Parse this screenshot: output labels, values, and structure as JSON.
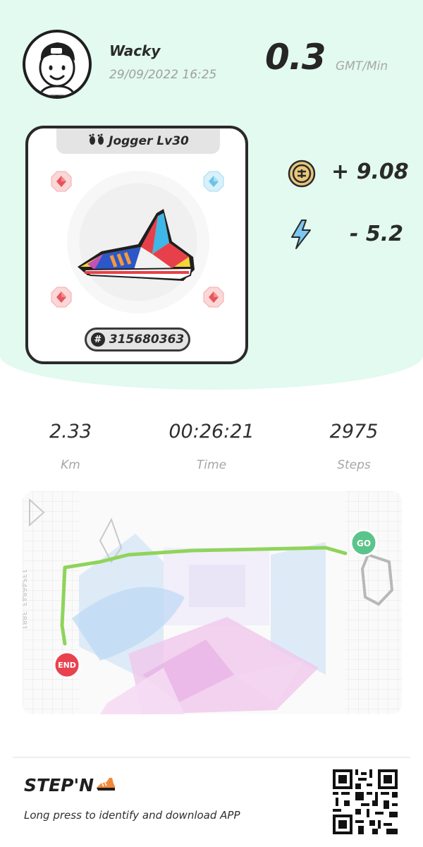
{
  "profile": {
    "username": "Wacky",
    "datetime": "29/09/2022 16:25",
    "avatar_icon": "cartoon-avatar-icon"
  },
  "earning_rate": {
    "value": "0.3",
    "unit": "GMT/Min"
  },
  "sneaker": {
    "level_label": "Jogger Lv30",
    "level_icon": "footprints-icon",
    "id_number": "315680363",
    "id_icon": "hash-icon",
    "socket_colors": {
      "red": "#f07a7a",
      "blue": "#8fd4ee"
    }
  },
  "rewards": [
    {
      "icon": "gst-coin-icon",
      "value": "+ 9.08",
      "color": "#e8c67a"
    },
    {
      "icon": "lightning-bolt-icon",
      "value": "- 5.2",
      "color": "#7cc8f4"
    }
  ],
  "stats": [
    {
      "value": "2.33",
      "label": "Km"
    },
    {
      "value": "00:26:21",
      "label": "Time"
    },
    {
      "value": "2975",
      "label": "Steps"
    }
  ],
  "map": {
    "start_label": "GO",
    "end_label": "END",
    "route_color": "#8fd45a",
    "watermark": "13546843 3881"
  },
  "footer": {
    "brand": "STEP'N",
    "tagline": "Long press to identify and download APP",
    "qr_icon": "qr-code-icon"
  },
  "colors": {
    "top_background": "#e2faf0",
    "go_marker": "#5bc48a",
    "end_marker": "#e8424f"
  }
}
